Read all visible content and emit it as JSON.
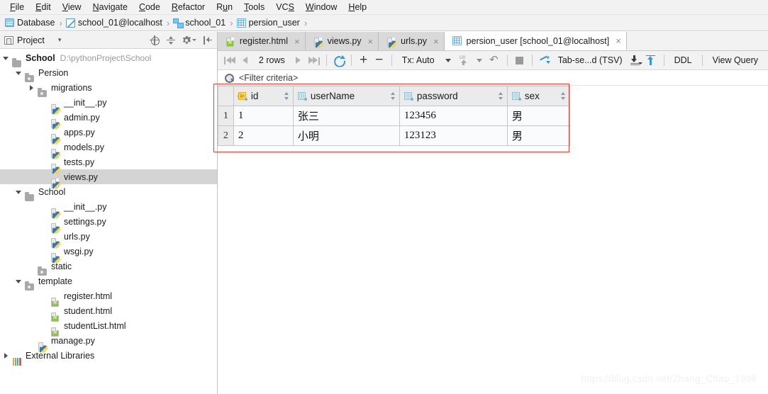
{
  "menubar": {
    "items": [
      {
        "label": "File",
        "mnemonic": "F"
      },
      {
        "label": "Edit",
        "mnemonic": "E"
      },
      {
        "label": "View",
        "mnemonic": "V"
      },
      {
        "label": "Navigate",
        "mnemonic": "N"
      },
      {
        "label": "Code",
        "mnemonic": "C"
      },
      {
        "label": "Refactor",
        "mnemonic": "R"
      },
      {
        "label": "Run",
        "mnemonic": "u"
      },
      {
        "label": "Tools",
        "mnemonic": "T"
      },
      {
        "label": "VCS",
        "mnemonic": "S"
      },
      {
        "label": "Window",
        "mnemonic": "W"
      },
      {
        "label": "Help",
        "mnemonic": "H"
      }
    ]
  },
  "breadcrumb": {
    "separator": "›",
    "items": [
      {
        "label": "Database",
        "icon": "database-grid-icon"
      },
      {
        "label": "school_01@localhost",
        "icon": "datasource-icon"
      },
      {
        "label": "school_01",
        "icon": "schema-icon"
      },
      {
        "label": "persion_user",
        "icon": "table-icon"
      }
    ]
  },
  "project_panel": {
    "title": "Project",
    "caret": "▾",
    "tools": [
      {
        "name": "locate-icon"
      },
      {
        "name": "collapse-all-icon"
      },
      {
        "name": "settings-gear-icon"
      },
      {
        "name": "hide-panel-icon"
      }
    ],
    "tree": [
      {
        "label": "School",
        "path": "D:\\pythonProject\\School",
        "icon": "folder-icon",
        "twisty": "open",
        "indent": 0,
        "bold": true,
        "selected": false
      },
      {
        "label": "Persion",
        "path": "",
        "icon": "folder-module-icon",
        "twisty": "open",
        "indent": 1,
        "bold": false,
        "selected": false
      },
      {
        "label": "migrations",
        "path": "",
        "icon": "folder-module-icon",
        "twisty": "closed",
        "indent": 2,
        "bold": false,
        "selected": false
      },
      {
        "label": "__init__.py",
        "path": "",
        "icon": "python-file-icon",
        "twisty": "none",
        "indent": 3,
        "bold": false,
        "selected": false
      },
      {
        "label": "admin.py",
        "path": "",
        "icon": "python-file-icon",
        "twisty": "none",
        "indent": 3,
        "bold": false,
        "selected": false
      },
      {
        "label": "apps.py",
        "path": "",
        "icon": "python-file-icon",
        "twisty": "none",
        "indent": 3,
        "bold": false,
        "selected": false
      },
      {
        "label": "models.py",
        "path": "",
        "icon": "python-file-icon",
        "twisty": "none",
        "indent": 3,
        "bold": false,
        "selected": false
      },
      {
        "label": "tests.py",
        "path": "",
        "icon": "python-file-icon",
        "twisty": "none",
        "indent": 3,
        "bold": false,
        "selected": false
      },
      {
        "label": "views.py",
        "path": "",
        "icon": "python-file-icon",
        "twisty": "none",
        "indent": 3,
        "bold": false,
        "selected": true
      },
      {
        "label": "School",
        "path": "",
        "icon": "folder-icon",
        "twisty": "open",
        "indent": 1,
        "bold": false,
        "selected": false
      },
      {
        "label": "__init__.py",
        "path": "",
        "icon": "python-file-icon",
        "twisty": "none",
        "indent": 3,
        "bold": false,
        "selected": false
      },
      {
        "label": "settings.py",
        "path": "",
        "icon": "python-file-icon",
        "twisty": "none",
        "indent": 3,
        "bold": false,
        "selected": false
      },
      {
        "label": "urls.py",
        "path": "",
        "icon": "python-file-icon",
        "twisty": "none",
        "indent": 3,
        "bold": false,
        "selected": false
      },
      {
        "label": "wsgi.py",
        "path": "",
        "icon": "python-file-icon",
        "twisty": "none",
        "indent": 3,
        "bold": false,
        "selected": false
      },
      {
        "label": "static",
        "path": "",
        "icon": "folder-module-icon",
        "twisty": "none",
        "indent": 2,
        "bold": false,
        "selected": false
      },
      {
        "label": "template",
        "path": "",
        "icon": "folder-module-icon",
        "twisty": "open",
        "indent": 1,
        "bold": false,
        "selected": false
      },
      {
        "label": "register.html",
        "path": "",
        "icon": "html-file-icon",
        "twisty": "none",
        "indent": 3,
        "bold": false,
        "selected": false
      },
      {
        "label": "student.html",
        "path": "",
        "icon": "html-file-icon",
        "twisty": "none",
        "indent": 3,
        "bold": false,
        "selected": false
      },
      {
        "label": "studentList.html",
        "path": "",
        "icon": "html-file-icon",
        "twisty": "none",
        "indent": 3,
        "bold": false,
        "selected": false
      },
      {
        "label": "manage.py",
        "path": "",
        "icon": "python-file-icon",
        "twisty": "none",
        "indent": 2,
        "bold": false,
        "selected": false
      },
      {
        "label": "External Libraries",
        "path": "",
        "icon": "external-libraries-icon",
        "twisty": "closed",
        "indent": 0,
        "bold": false,
        "selected": false
      }
    ]
  },
  "editor": {
    "tabs": [
      {
        "label": "register.html",
        "icon": "html-file-icon",
        "active": false,
        "close": "×"
      },
      {
        "label": "views.py",
        "icon": "python-file-icon",
        "active": false,
        "close": "×"
      },
      {
        "label": "urls.py",
        "icon": "python-file-icon",
        "active": false,
        "close": "×"
      },
      {
        "label": "persion_user [school_01@localhost]",
        "icon": "table-icon",
        "active": true,
        "close": "×"
      }
    ]
  },
  "grid_toolbar": {
    "first_page": "first-page-icon",
    "prev_page": "prev-page-icon",
    "rows_label": "2 rows",
    "next_page": "next-page-icon",
    "last_page": "last-page-icon",
    "refresh": "refresh-icon",
    "add_row": "+",
    "delete_row": "−",
    "tx_label": "Tx: Auto",
    "tx_caret": "⌄",
    "submit": "db-submit-icon",
    "submit_caret": "chevron-down-icon",
    "revert": "revert-icon",
    "stop": "stop-icon",
    "modify": "modify-icon",
    "format_label": "Tab-se...d (TSV)",
    "import_icon": "import-data-icon",
    "export_icon": "export-data-icon",
    "ddl_label": "DDL",
    "view_query_label": "View Query"
  },
  "filter": {
    "icon": "filter-search-icon",
    "placeholder": "<Filter criteria>"
  },
  "table": {
    "columns": [
      {
        "name": "id",
        "icon": "primary-key-column-icon",
        "sort": "sort-toggle-icon"
      },
      {
        "name": "userName",
        "icon": "column-icon",
        "sort": "sort-toggle-icon"
      },
      {
        "name": "password",
        "icon": "column-icon",
        "sort": "sort-toggle-icon"
      },
      {
        "name": "sex",
        "icon": "column-icon",
        "sort": "sort-toggle-icon"
      }
    ],
    "rows": [
      {
        "num": "1",
        "id": "1",
        "userName": "张三",
        "password": "123456",
        "sex": "男"
      },
      {
        "num": "2",
        "id": "2",
        "userName": "小明",
        "password": "123123",
        "sex": "男"
      }
    ]
  },
  "watermark": {
    "text": "https://blog.csdn.net/Zhang_Chao_1998"
  },
  "colors": {
    "accent": "#2e9bd6",
    "annotation_red": "#e8392a",
    "selection_gray": "#d4d4d4",
    "chrome_gray": "#f2f2f2"
  }
}
